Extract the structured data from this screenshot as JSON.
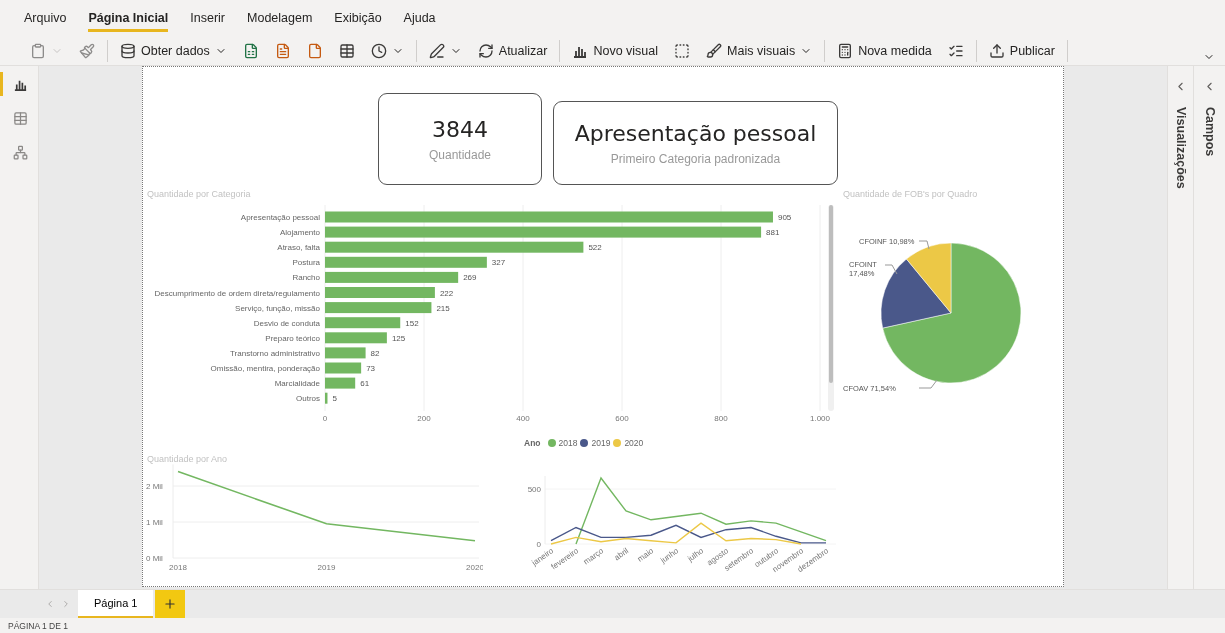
{
  "ribbon": {
    "tabs": [
      {
        "label": "Arquivo",
        "selected": false
      },
      {
        "label": "Página Inicial",
        "selected": true
      },
      {
        "label": "Inserir",
        "selected": false
      },
      {
        "label": "Modelagem",
        "selected": false
      },
      {
        "label": "Exibição",
        "selected": false
      },
      {
        "label": "Ajuda",
        "selected": false
      }
    ]
  },
  "toolbar": {
    "groups": [
      [
        {
          "caret": true,
          "disabled": true
        },
        {
          "caret": false,
          "disabled": true
        }
      ],
      [
        {
          "label": "Obter dados",
          "caret": true,
          "disabled": false
        },
        {
          "caret": false,
          "disabled": false
        },
        {
          "caret": false,
          "disabled": false
        },
        {
          "caret": false,
          "disabled": false
        },
        {
          "caret": false,
          "disabled": false
        },
        {
          "caret": true,
          "disabled": false
        }
      ],
      [
        {
          "caret": true,
          "disabled": false
        },
        {
          "label": "Atualizar",
          "caret": false,
          "disabled": false
        }
      ],
      [
        {
          "label": "Novo visual",
          "caret": false,
          "disabled": false
        },
        {
          "caret": false,
          "disabled": false
        },
        {
          "label": "Mais visuais",
          "caret": true,
          "disabled": false
        }
      ],
      [
        {
          "label": "Nova medida",
          "caret": false,
          "disabled": false
        },
        {
          "caret": false,
          "disabled": false
        }
      ],
      [
        {
          "label": "Publicar",
          "caret": false,
          "disabled": false
        }
      ]
    ]
  },
  "view_switcher": [
    {
      "selected": true
    },
    {
      "selected": false
    },
    {
      "selected": false
    }
  ],
  "report": {
    "cards": [
      {
        "value": "3844",
        "label": "Quantidade"
      },
      {
        "value": "Apresentação pessoal",
        "label": "Primeiro Categoria padronizada"
      }
    ],
    "bar_chart": {
      "chart_data": {
        "type": "bar",
        "orientation": "horizontal",
        "title": "Quantidade por Categoria",
        "categories": [
          "Apresentação pessoal",
          "Alojamento",
          "Atraso, falta",
          "Postura",
          "Rancho",
          "Descumprimento de ordem direta/regulamento",
          "Serviço, função, missão",
          "Desvio de conduta",
          "Preparo teórico",
          "Transtorno administrativo",
          "Omissão, mentira, ponderação",
          "Marcialidade",
          "Outros"
        ],
        "values": [
          905,
          881,
          522,
          327,
          269,
          222,
          215,
          152,
          125,
          82,
          73,
          61,
          5
        ],
        "xlim": [
          0,
          1000
        ],
        "xticks": [
          0,
          200,
          400,
          600,
          800,
          {
            "value": 1000,
            "label": "1.000"
          }
        ],
        "grid": true,
        "data_labels": true
      }
    },
    "pie_chart": {
      "chart_data": {
        "type": "pie",
        "title": "Quantidade de FOB's por Quadro",
        "categories": [
          "CFOAV",
          "CFOINT",
          "CFOINF"
        ],
        "values": [
          71.54,
          17.48,
          10.98
        ],
        "colors": [
          "#73b761",
          "#4a588a",
          "#ecc846"
        ],
        "value_labels": [
          "71,54%",
          "17,48%",
          "10,98%"
        ]
      }
    },
    "year_chart": {
      "chart_data": {
        "type": "line",
        "title": "Quantidade por Ano",
        "x": [
          "2018",
          "2019",
          "2020"
        ],
        "values": [
          2.4,
          0.95,
          0.48
        ],
        "ylim": [
          0,
          2.6
        ],
        "yticks": [
          {
            "value": 0,
            "label": "0 Mil"
          },
          {
            "value": 1,
            "label": "1 Mil"
          },
          {
            "value": 2,
            "label": "2 Mil"
          }
        ],
        "grid": true
      }
    },
    "month_chart": {
      "chart_data": {
        "type": "line",
        "legend": {
          "title": "Ano"
        },
        "x": [
          "janeiro",
          "fevereiro",
          "março",
          "abril",
          "maio",
          "junho",
          "julho",
          "agosto",
          "setembro",
          "outubro",
          "novembro",
          "dezembro"
        ],
        "series": [
          {
            "name": "2018",
            "color": "#73b761",
            "values": [
              null,
              0,
              600,
              300,
              220,
              250,
              280,
              180,
              210,
              190,
              110,
              30
            ]
          },
          {
            "name": "2019",
            "color": "#4a588a",
            "values": [
              30,
              150,
              60,
              60,
              80,
              170,
              60,
              130,
              150,
              70,
              10,
              10
            ]
          },
          {
            "name": "2020",
            "color": "#ecc846",
            "values": [
              0,
              60,
              20,
              50,
              30,
              10,
              190,
              30,
              50,
              40,
              0,
              null
            ]
          }
        ],
        "ylim": [
          0,
          620
        ],
        "yticks": [
          0,
          500
        ]
      }
    }
  },
  "panes": [
    {
      "title": "Visualizações"
    },
    {
      "title": "Campos"
    }
  ],
  "page_tabs": [
    {
      "label": "Página 1",
      "selected": true
    }
  ],
  "status_bar": "PÁGINA 1 DE 1"
}
